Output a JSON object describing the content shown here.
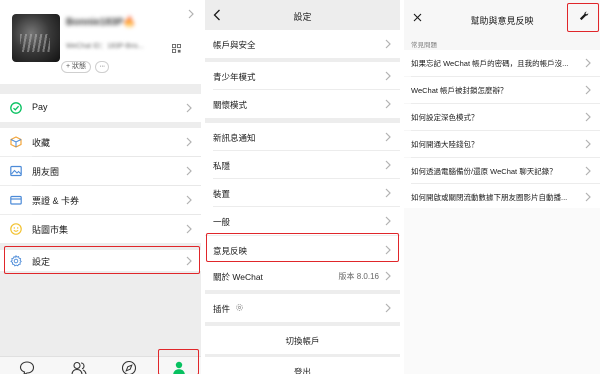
{
  "me": {
    "nickname": "Bonnie183P",
    "nickname_badge": "🔥",
    "wechat_id": "WeChat ID：183P-Bris...",
    "status_label": "+ 狀態",
    "more_label": "···",
    "menu": [
      {
        "label": "Pay",
        "icon": "pay-icon"
      },
      {
        "label": "收藏",
        "icon": "favorites-icon"
      },
      {
        "label": "朋友圈",
        "icon": "moments-icon"
      },
      {
        "label": "票證 & 卡券",
        "icon": "cards-icon"
      },
      {
        "label": "貼圖市集",
        "icon": "sticker-icon"
      },
      {
        "label": "設定",
        "icon": "settings-icon"
      }
    ],
    "tabs": [
      "chats-tab-icon",
      "contacts-tab-icon",
      "discover-tab-icon",
      "me-tab-icon"
    ]
  },
  "settings": {
    "title": "設定",
    "items": [
      "帳戶與安全",
      "青少年模式",
      "關懷模式",
      "新訊息通知",
      "私隱",
      "裝置",
      "一般",
      "意見反映",
      "關於 WeChat",
      "插件"
    ],
    "version": "版本 8.0.16",
    "switch_account": "切換帳戶",
    "logout": "登出"
  },
  "help": {
    "title": "幫助與意見反映",
    "faq_header": "常見問題",
    "faqs": [
      "如果忘記 WeChat 帳戶的密碼，且我的帳戶沒...",
      "WeChat 帳戶被封鎖怎麼辦？",
      "如何設定深色模式？",
      "如何開通大陸錢包？",
      "如何透過電腦備份/還原 WeChat 聊天記錄？",
      "如何開啟或關閉流動數據下朋友圈影片自動播..."
    ]
  },
  "colors": {
    "highlight": "#e0262a",
    "wechat_green": "#07c160",
    "background": "#ededed"
  }
}
